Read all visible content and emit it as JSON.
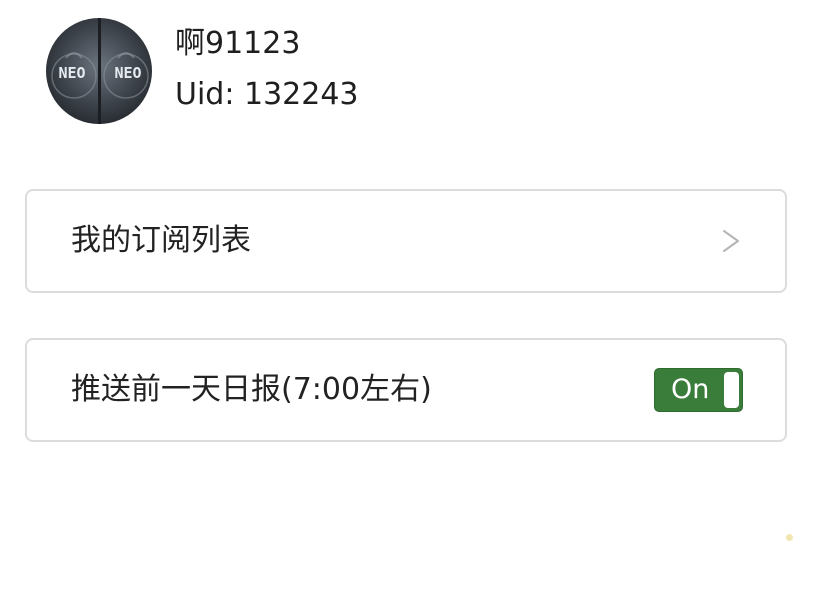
{
  "profile": {
    "username": "啊91123",
    "uid_text": "Uid: 132243",
    "avatar_text_left": "NEO",
    "avatar_text_right": "NEO"
  },
  "menu": {
    "subscriptions_label": "我的订阅列表",
    "chevron_glyph": ">"
  },
  "settings": {
    "daily_push_label": "推送前一天日报(7:00左右)",
    "daily_push_state": "On"
  },
  "colors": {
    "toggle_on": "#3a7d3a",
    "card_border": "#dcdcdc",
    "chevron": "#b5b5b5"
  }
}
